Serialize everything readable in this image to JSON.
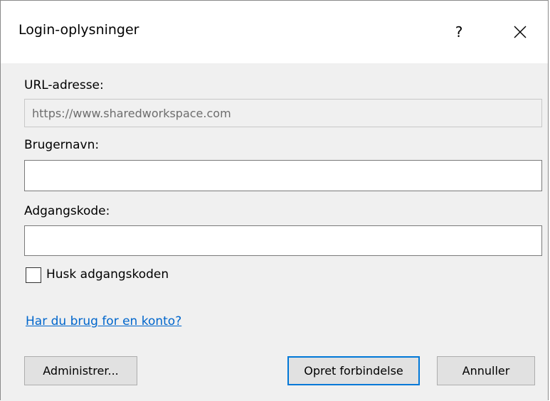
{
  "window": {
    "title": "Login-oplysninger",
    "help_label": "?"
  },
  "form": {
    "url_label": "URL-adresse:",
    "url_value": "https://www.sharedworkspace.com",
    "username_label": "Brugernavn:",
    "username_value": "",
    "password_label": "Adgangskode:",
    "password_value": "",
    "remember_label": "Husk adgangskoden",
    "remember_checked": false,
    "account_link": "Har du brug for en konto?"
  },
  "buttons": {
    "manage": "Administrer...",
    "connect": "Opret forbindelse",
    "cancel": "Annuller"
  },
  "colors": {
    "link": "#0066cc",
    "content_bg": "#f0f0f0",
    "button_bg": "#e1e1e1"
  }
}
